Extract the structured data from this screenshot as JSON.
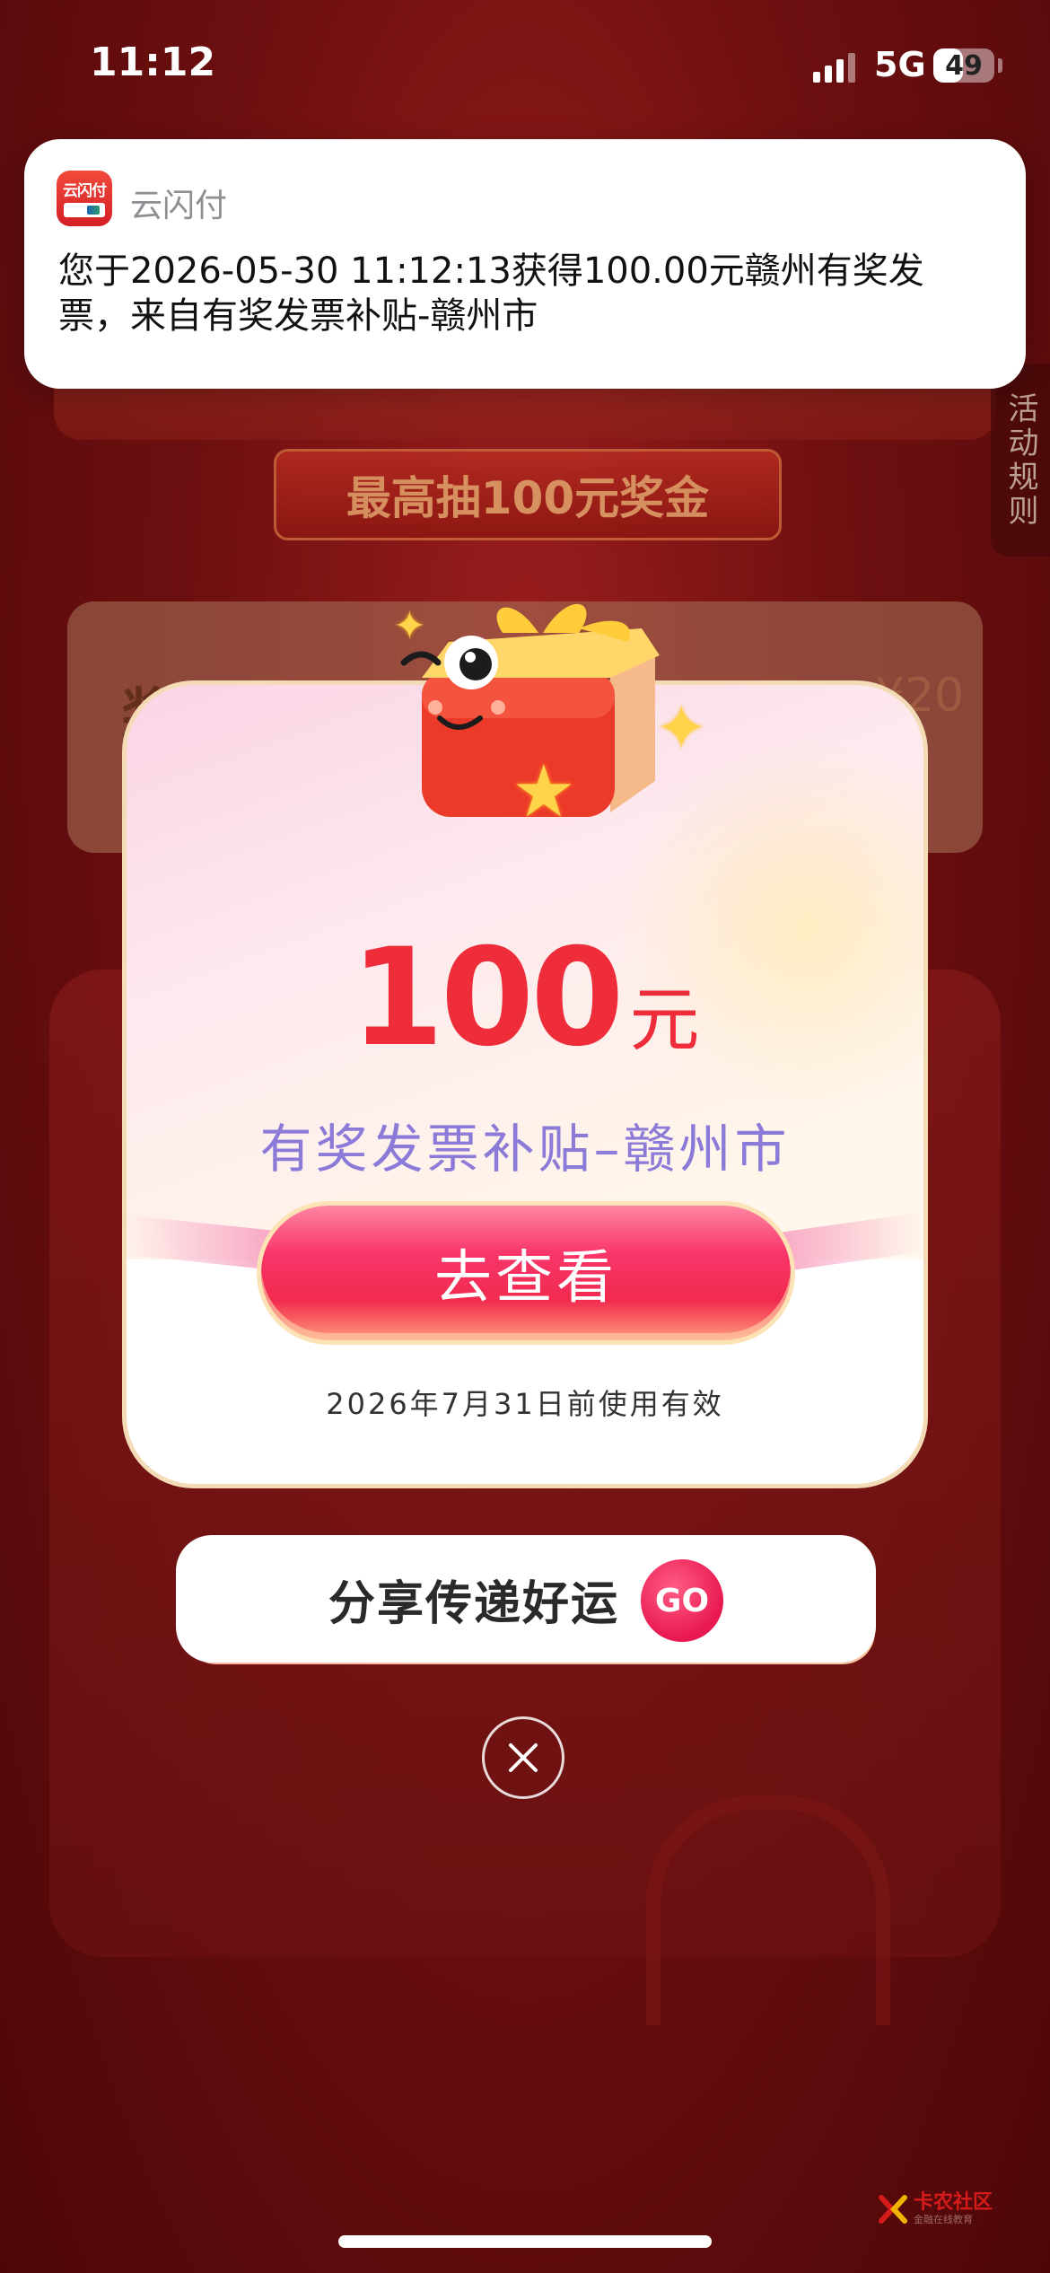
{
  "status_bar": {
    "time": "11:12",
    "network": "5G",
    "battery": "49",
    "battery_level": 0.49
  },
  "notification": {
    "app_icon_text": "云闪付",
    "app_name": "云闪付",
    "body": "您于2026-05-30 11:12:13获得100.00元赣州有奖发票，来自有奖发票补贴-赣州市"
  },
  "background": {
    "banner_subtitle": "最高抽100元奖金",
    "rules_tab": "活动规则",
    "panel_label": "奖",
    "panel_price": "¥20"
  },
  "popup": {
    "amount": "100",
    "unit": "元",
    "subsidy_title": "有奖发票补贴–赣州市",
    "view_button": "去查看",
    "valid_until": "2026年7月31日前使用有效"
  },
  "share": {
    "label": "分享传递好运",
    "go": "GO"
  },
  "watermark": {
    "name": "卡农社区",
    "tagline": "金融在线教育"
  },
  "colors": {
    "accent_red": "#ee2c3a",
    "subsidy_purple": "#8b7ad7",
    "button_pink": "#f8366a",
    "background_red": "#6d0f10"
  }
}
